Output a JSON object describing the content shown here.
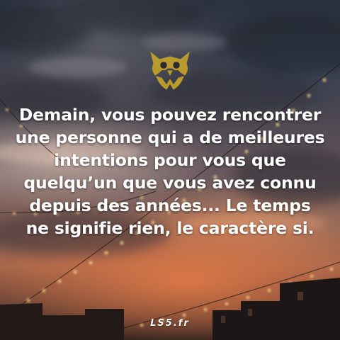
{
  "quote": {
    "lines": [
      "Demain, vous pouvez rencontrer",
      "une personne qui a de meilleures",
      "intentions pour vous que",
      "quelqu’un que vous avez connu",
      "depuis des années... Le temps",
      "ne signifie rien, le caractère si."
    ]
  },
  "watermark": "LS5.fr",
  "logo": {
    "icon": "owl-logo-icon",
    "color": "#b99a2c"
  },
  "colors": {
    "text": "#ffffff",
    "sky_top": "#2c3140",
    "sunset": "#a4664c",
    "lights": "#ffd98a"
  }
}
